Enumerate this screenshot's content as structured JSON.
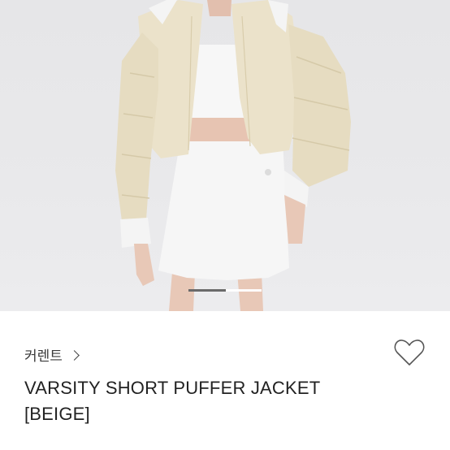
{
  "product": {
    "category_label": "커렌트",
    "title_line1": "VARSITY SHORT PUFFER JACKET",
    "title_line2": "[BEIGE]"
  },
  "carousel": {
    "current_index": 1,
    "total": 2
  },
  "colors": {
    "background": "#e8e8ea",
    "jacket": "#e9e0c8",
    "skirt": "#f4f4f4"
  },
  "icons": {
    "chevron": "chevron-right-icon",
    "favorite": "heart-outline-icon"
  }
}
